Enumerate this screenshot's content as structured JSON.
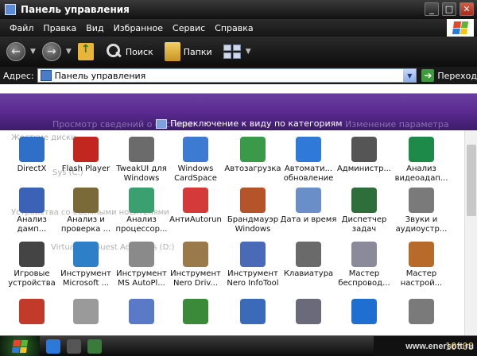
{
  "window": {
    "title": "Панель управления"
  },
  "menu": [
    "Файл",
    "Правка",
    "Вид",
    "Избранное",
    "Сервис",
    "Справка"
  ],
  "toolbar": {
    "search_label": "Поиск",
    "folders_label": "Папки"
  },
  "address": {
    "label": "Адрес:",
    "value": "Панель управления",
    "go_label": "Переход"
  },
  "banner": {
    "switch_label": "Переключение к виду по категориям",
    "ghost_left": "Просмотр сведений о системе",
    "ghost_right": "Изменение параметра"
  },
  "ghost": {
    "disks": "Жесткие диски",
    "sys": "Sys (C:)",
    "removable": "Устройства со съемными носителями",
    "guest": "VirtualBox Guest Additions (D:)"
  },
  "icons": [
    {
      "label": "DirectX",
      "icon": "directx-icon",
      "color": "#2f6fc7"
    },
    {
      "label": "Flash Player",
      "icon": "flash-icon",
      "color": "#c1271f"
    },
    {
      "label": "TweakUI для Windows",
      "icon": "tweakui-icon",
      "color": "#6b6b6b"
    },
    {
      "label": "Windows CardSpace",
      "icon": "cardspace-icon",
      "color": "#3c7bd1"
    },
    {
      "label": "Автозагрузка",
      "icon": "autorun-icon",
      "color": "#3a9a4a"
    },
    {
      "label": "Автомати... обновление",
      "icon": "update-icon",
      "color": "#2f7ad9"
    },
    {
      "label": "Администр...",
      "icon": "admin-tools-icon",
      "color": "#555555"
    },
    {
      "label": "Анализ видеоадап...",
      "icon": "video-card-icon",
      "color": "#1e8a4a"
    },
    {
      "label": "Анализ дамп...",
      "icon": "dump-analysis-icon",
      "color": "#3c62b8"
    },
    {
      "label": "Анализ и проверка ...",
      "icon": "disk-check-icon",
      "color": "#7a6a3a"
    },
    {
      "label": "Анализ процессор...",
      "icon": "cpu-icon",
      "color": "#3aa070"
    },
    {
      "label": "АнтиAutorun",
      "icon": "antiautorun-icon",
      "color": "#d43a3a"
    },
    {
      "label": "Брандмауэр Windows",
      "icon": "firewall-icon",
      "color": "#b5532a"
    },
    {
      "label": "Дата и время",
      "icon": "clock-icon",
      "color": "#6a8ec7"
    },
    {
      "label": "Диспетчер задач",
      "icon": "task-manager-icon",
      "color": "#2d6e3a"
    },
    {
      "label": "Звуки и аудиоустр...",
      "icon": "speaker-icon",
      "color": "#7a7a7a"
    },
    {
      "label": "Игровые устройства",
      "icon": "gamepad-icon",
      "color": "#444444"
    },
    {
      "label": "Инструмент Microsoft ...",
      "icon": "ms-tool-icon",
      "color": "#2d7fc7"
    },
    {
      "label": "Инструмент MS AutoPl...",
      "icon": "autoplay-icon",
      "color": "#8a8a8a"
    },
    {
      "label": "Инструмент Nero Driv...",
      "icon": "nero-drive-icon",
      "color": "#9a7a4a"
    },
    {
      "label": "Инструмент Nero InfoTool",
      "icon": "nero-info-icon",
      "color": "#4a6ab8"
    },
    {
      "label": "Клавиатура",
      "icon": "keyboard-icon",
      "color": "#6a6a6a"
    },
    {
      "label": "Мастер беспровод...",
      "icon": "wireless-icon",
      "color": "#8a8a9a"
    },
    {
      "label": "Мастер настрой...",
      "icon": "network-setup-icon",
      "color": "#b86a2a"
    },
    {
      "label": "",
      "icon": "speedometer-icon",
      "color": "#c23a2a"
    },
    {
      "label": "",
      "icon": "mouse-icon",
      "color": "#9a9a9a"
    },
    {
      "label": "",
      "icon": "media-icon",
      "color": "#5a7ac7"
    },
    {
      "label": "",
      "icon": "fonts-icon",
      "color": "#3a8a3a"
    },
    {
      "label": "",
      "icon": "display-icon",
      "color": "#3a6ab8"
    },
    {
      "label": "",
      "icon": "network-icon",
      "color": "#6a6a7a"
    },
    {
      "label": "",
      "icon": "ie-icon",
      "color": "#1e6fd1"
    },
    {
      "label": "",
      "icon": "system-icon",
      "color": "#7a7a7a"
    }
  ],
  "tray": {
    "clock": "10:08",
    "watermark": "www.enersoft.ru"
  }
}
